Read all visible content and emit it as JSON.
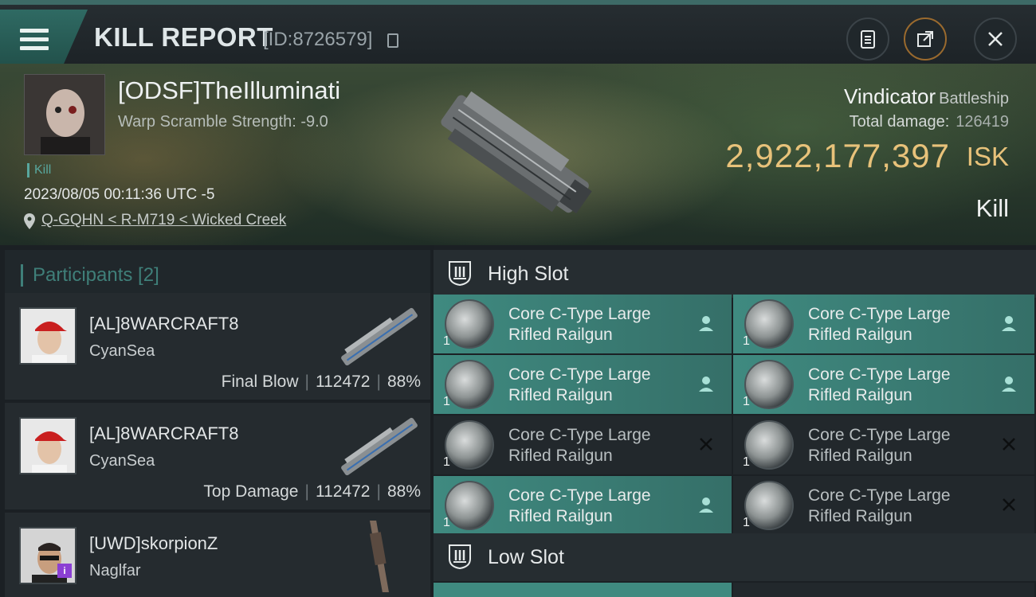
{
  "header": {
    "title": "KILL REPORT",
    "report_id": "[ID:8726579]"
  },
  "victim": {
    "name": "[ODSF]TheIlluminati",
    "warp_scramble": "Warp Scramble Strength: -9.0",
    "kill_tag": "Kill",
    "datetime": "2023/08/05 00:11:36 UTC -5",
    "location": "Q-GQHN < R-M719 < Wicked Creek",
    "ship_name": "Vindicator",
    "ship_class": "Battleship",
    "total_damage_label": "Total damage:",
    "total_damage_value": "126419",
    "isk_value": "2,922,177,397",
    "isk_unit": "ISK",
    "result": "Kill"
  },
  "participants": {
    "title": "Participants [2]",
    "rows": [
      {
        "name": "[AL]8WARCRAFT8",
        "ship": "CyanSea",
        "role": "Final Blow",
        "damage": "112472",
        "percent": "88%"
      },
      {
        "name": "[AL]8WARCRAFT8",
        "ship": "CyanSea",
        "role": "Top Damage",
        "damage": "112472",
        "percent": "88%"
      },
      {
        "name": "[UWD]skorpionZ",
        "ship": "Naglfar"
      }
    ]
  },
  "slots": {
    "high": {
      "title": "High Slot",
      "modules": [
        {
          "line1": "Core C-Type Large",
          "line2": "Rifled Railgun",
          "qty": "1",
          "status": "dropped"
        },
        {
          "line1": "Core C-Type Large",
          "line2": "Rifled Railgun",
          "qty": "1",
          "status": "dropped"
        },
        {
          "line1": "Core C-Type Large",
          "line2": "Rifled Railgun",
          "qty": "1",
          "status": "dropped"
        },
        {
          "line1": "Core C-Type Large",
          "line2": "Rifled Railgun",
          "qty": "1",
          "status": "dropped"
        },
        {
          "line1": "Core C-Type Large",
          "line2": "Rifled Railgun",
          "qty": "1",
          "status": "destroyed"
        },
        {
          "line1": "Core C-Type Large",
          "line2": "Rifled Railgun",
          "qty": "1",
          "status": "destroyed"
        },
        {
          "line1": "Core C-Type Large",
          "line2": "Rifled Railgun",
          "qty": "1",
          "status": "dropped"
        },
        {
          "line1": "Core C-Type Large",
          "line2": "Rifled Railgun",
          "qty": "1",
          "status": "destroyed"
        }
      ]
    },
    "low": {
      "title": "Low Slot"
    }
  },
  "colors": {
    "accent_teal": "#3f8a80",
    "isk_gold": "#e8c27a"
  },
  "icons": {
    "menu": "menu-icon",
    "copy": "copy-icon",
    "clipboard": "clipboard-icon",
    "share": "share-icon",
    "close": "close-icon",
    "location": "location-pin-icon",
    "dropped": "person-icon",
    "destroyed": "x-icon"
  }
}
